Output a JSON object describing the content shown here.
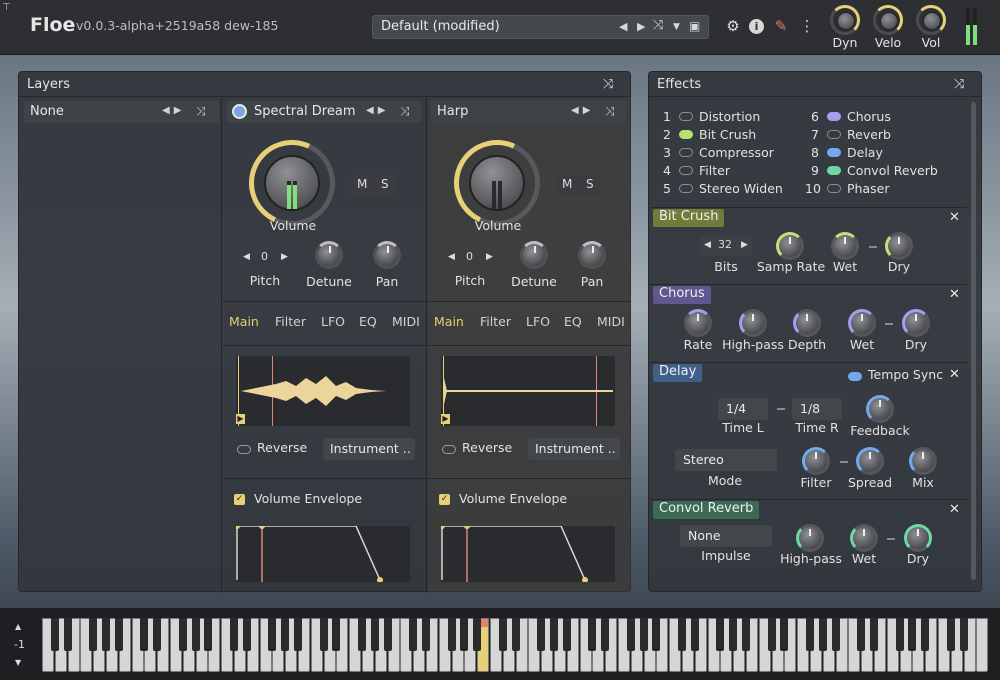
{
  "app": {
    "name": "Floe",
    "version": "v0.0.3-alpha+2519a58  dew-185"
  },
  "preset": {
    "name": "Default (modified)"
  },
  "top_knobs": [
    {
      "label": "Dyn"
    },
    {
      "label": "Velo"
    },
    {
      "label": "Vol"
    }
  ],
  "colors": {
    "accent": "#e8d07a",
    "panel": "#33373d",
    "bitcrush": "#6f7c3a",
    "chorus": "#5e5790",
    "delay": "#3f5f8a",
    "convol": "#3b6b52"
  },
  "layers_panel": {
    "title": "Layers",
    "empty_layer": {
      "name": "None"
    },
    "layers": [
      {
        "name": "Spectral Dream",
        "volume_label": "Volume",
        "mute": "M",
        "solo": "S",
        "pitch_value": "0",
        "pitch_label": "Pitch",
        "detune_label": "Detune",
        "pan_label": "Pan",
        "tabs": [
          "Main",
          "Filter",
          "LFO",
          "EQ",
          "MIDI"
        ],
        "reverse_label": "Reverse",
        "instrument_dropdown": "Instrument ..",
        "envelope_label": "Volume Envelope"
      },
      {
        "name": "Harp",
        "volume_label": "Volume",
        "mute": "M",
        "solo": "S",
        "pitch_value": "0",
        "pitch_label": "Pitch",
        "detune_label": "Detune",
        "pan_label": "Pan",
        "tabs": [
          "Main",
          "Filter",
          "LFO",
          "EQ",
          "MIDI"
        ],
        "reverse_label": "Reverse",
        "instrument_dropdown": "Instrument ..",
        "envelope_label": "Volume Envelope"
      }
    ]
  },
  "effects_panel": {
    "title": "Effects",
    "list_left": [
      {
        "num": "1",
        "name": "Distortion",
        "state": "off"
      },
      {
        "num": "2",
        "name": "Bit Crush",
        "state": "green"
      },
      {
        "num": "3",
        "name": "Compressor",
        "state": "off"
      },
      {
        "num": "4",
        "name": "Filter",
        "state": "off"
      },
      {
        "num": "5",
        "name": "Stereo Widen",
        "state": "off"
      }
    ],
    "list_right": [
      {
        "num": "6",
        "name": "Chorus",
        "state": "purple"
      },
      {
        "num": "7",
        "name": "Reverb",
        "state": "off"
      },
      {
        "num": "8",
        "name": "Delay",
        "state": "blue"
      },
      {
        "num": "9",
        "name": "Convol Reverb",
        "state": "teal"
      },
      {
        "num": "10",
        "name": "Phaser",
        "state": "off"
      }
    ],
    "bitcrush": {
      "title": "Bit Crush",
      "bits_value": "32",
      "bits_label": "Bits",
      "samp_rate": "Samp Rate",
      "wet": "Wet",
      "dry": "Dry"
    },
    "chorus": {
      "title": "Chorus",
      "rate": "Rate",
      "highpass": "High-pass",
      "depth": "Depth",
      "wet": "Wet",
      "dry": "Dry"
    },
    "delay": {
      "title": "Delay",
      "tempo_sync": "Tempo Sync",
      "time_l_value": "1/4",
      "time_l": "Time L",
      "time_r_value": "1/8",
      "time_r": "Time R",
      "feedback": "Feedback",
      "mode_value": "Stereo",
      "mode": "Mode",
      "filter": "Filter",
      "spread": "Spread",
      "mix": "Mix"
    },
    "convol": {
      "title": "Convol Reverb",
      "impulse_value": "None",
      "impulse": "Impulse",
      "highpass": "High-pass",
      "wet": "Wet",
      "dry": "Dry"
    }
  },
  "keyboard": {
    "octave": "-1"
  }
}
